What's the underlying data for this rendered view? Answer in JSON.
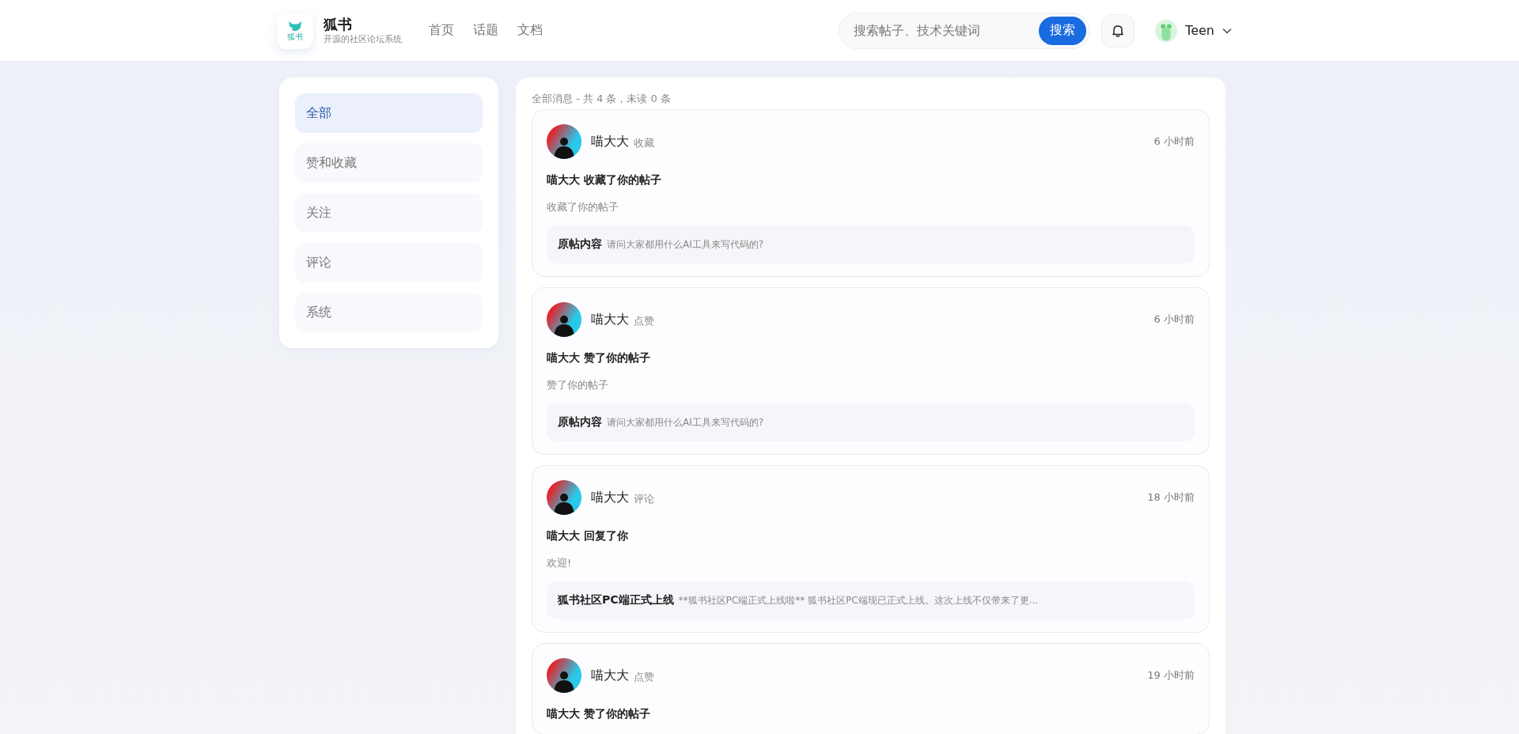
{
  "header": {
    "logo_badge": "狐书",
    "brand": "狐书",
    "tagline": "开源的社区论坛系统",
    "nav": [
      {
        "label": "首页",
        "selected": false
      },
      {
        "label": "话题",
        "selected": false
      },
      {
        "label": "文档",
        "selected": false
      }
    ],
    "search": {
      "placeholder": "搜索帖子、技术关键词",
      "button": "搜索"
    },
    "user": {
      "name": "Teen"
    }
  },
  "sidebar": {
    "items": [
      {
        "label": "全部",
        "selected": true
      },
      {
        "label": "赞和收藏",
        "selected": false
      },
      {
        "label": "关注",
        "selected": false
      },
      {
        "label": "评论",
        "selected": false
      },
      {
        "label": "系统",
        "selected": false
      }
    ]
  },
  "messages": {
    "summary": "全部消息 - 共 4 条，未读 0 条",
    "items": [
      {
        "user": "喵大大",
        "type": "收藏",
        "time": "6 小时前",
        "title": "喵大大 收藏了你的帖子",
        "desc": "收藏了你的帖子",
        "quote_label": "原帖内容",
        "quote": "请问大家都用什么AI工具来写代码的?"
      },
      {
        "user": "喵大大",
        "type": "点赞",
        "time": "6 小时前",
        "title": "喵大大 赞了你的帖子",
        "desc": "赞了你的帖子",
        "quote_label": "原帖内容",
        "quote": "请问大家都用什么AI工具来写代码的?"
      },
      {
        "user": "喵大大",
        "type": "评论",
        "time": "18 小时前",
        "title": "喵大大 回复了你",
        "desc": "欢迎!",
        "quote_label": "狐书社区PC端正式上线",
        "quote": "**狐书社区PC端正式上线啦** 狐书社区PC端现已正式上线。这次上线不仅带来了更..."
      },
      {
        "user": "喵大大",
        "type": "点赞",
        "time": "19 小时前",
        "title": "喵大大 赞了你的帖子"
      }
    ]
  }
}
